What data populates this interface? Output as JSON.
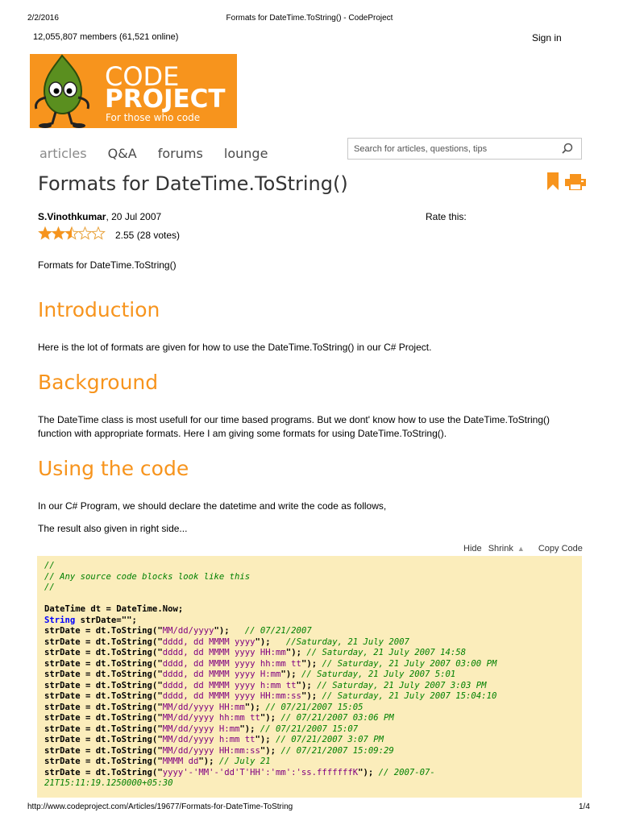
{
  "print_header": {
    "date": "2/2/2016",
    "title": "Formats for DateTime.ToString() - CodeProject"
  },
  "top_bar": {
    "members": "12,055,807 members (61,521 online)",
    "signin": "Sign in"
  },
  "logo": {
    "line1": "CODE",
    "line2": "PROJECT",
    "reg": "®",
    "tagline": "For those who code"
  },
  "nav": {
    "items": [
      "articles",
      "Q&A",
      "forums",
      "lounge"
    ]
  },
  "search": {
    "placeholder": "Search for articles, questions, tips",
    "icon": "search-icon"
  },
  "article": {
    "title": "Formats for DateTime.ToString()",
    "author": "S.Vinothkumar",
    "date": ", 20 Jul 2007",
    "rate_label": "Rate this:",
    "rating": {
      "stars_filled": 2.5,
      "stars_total": 5,
      "score": "2.55 (28 votes)"
    },
    "summary": "Formats for DateTime.ToString()",
    "sections": {
      "intro_heading": "Introduction",
      "intro_text": "Here is the lot of formats are given for how to use the DateTime.ToString() in our C# Project.",
      "background_heading": "Background",
      "background_text": "The DateTime class is most usefull for our time based programs. But we dont' know how to use the DateTime.ToString() function with appropriate formats. Here I am giving some formats for using DateTime.ToString().",
      "using_heading": "Using the code",
      "using_text1": "In our C# Program, we should declare the datetime and write the code as follows,",
      "using_text2": "The result also given in right side..."
    }
  },
  "code_tools": {
    "hide": "Hide",
    "shrink": "Shrink",
    "shrink_arrow": "▲",
    "copy": "Copy Code"
  },
  "code_lines": [
    "//",
    "// Any source code blocks look like this",
    "//",
    "",
    "DateTime dt = DateTime.Now;",
    "String strDate=\"\";",
    "strDate = dt.ToString(\"MM/dd/yyyy\");   // 07/21/2007",
    "strDate = dt.ToString(\"dddd, dd MMMM yyyy\");   //Saturday, 21 July 2007",
    "strDate = dt.ToString(\"dddd, dd MMMM yyyy HH:mm\"); // Saturday, 21 July 2007 14:58",
    "strDate = dt.ToString(\"dddd, dd MMMM yyyy hh:mm tt\"); // Saturday, 21 July 2007 03:00 PM",
    "strDate = dt.ToString(\"dddd, dd MMMM yyyy H:mm\"); // Saturday, 21 July 2007 5:01",
    "strDate = dt.ToString(\"dddd, dd MMMM yyyy h:mm tt\"); // Saturday, 21 July 2007 3:03 PM",
    "strDate = dt.ToString(\"dddd, dd MMMM yyyy HH:mm:ss\"); // Saturday, 21 July 2007 15:04:10",
    "strDate = dt.ToString(\"MM/dd/yyyy HH:mm\"); // 07/21/2007 15:05",
    "strDate = dt.ToString(\"MM/dd/yyyy hh:mm tt\"); // 07/21/2007 03:06 PM",
    "strDate = dt.ToString(\"MM/dd/yyyy H:mm\"); // 07/21/2007 15:07",
    "strDate = dt.ToString(\"MM/dd/yyyy h:mm tt\"); // 07/21/2007 3:07 PM",
    "strDate = dt.ToString(\"MM/dd/yyyy HH:mm:ss\"); // 07/21/2007 15:09:29",
    "strDate = dt.ToString(\"MMMM dd\"); // July 21",
    "strDate = dt.ToString(\"yyyy'-'MM'-'dd'T'HH':'mm':'ss.fffffffK\"); // 2007-07-",
    "21T15:11:19.1250000+05:30"
  ],
  "print_footer": {
    "url": "http://www.codeproject.com/Articles/19677/Formats-for-DateTime-ToString",
    "page": "1/4"
  },
  "colors": {
    "brand_orange": "#f7941d",
    "code_bg": "#fbedbb",
    "comment": "#008000",
    "string": "#800080",
    "keyword": "#0000ff"
  }
}
